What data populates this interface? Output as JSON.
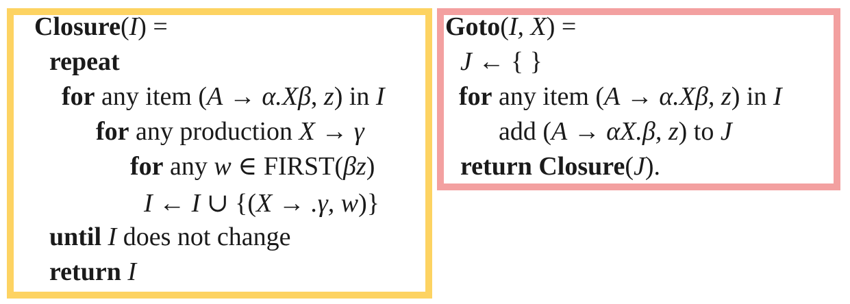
{
  "closure": {
    "heading": {
      "name": "Closure",
      "arg": "I",
      "suffix": ") ="
    },
    "repeat_kw": "repeat",
    "for_item": {
      "kw": "for",
      "pre": "any item (",
      "A": "A",
      "arrow": "→",
      "alpha": "α.",
      "X": "Xβ",
      "z": "z",
      "in": ") in",
      "I": "I"
    },
    "for_prod": {
      "kw": "for",
      "pre": "any production",
      "X": "X",
      "arrow": "→",
      "gamma": "γ"
    },
    "for_w": {
      "kw": "for",
      "pre": "any",
      "w": "w",
      "elem": "∈ FIRST(",
      "bz": "βz",
      "close": ")"
    },
    "assign": {
      "I1": "I",
      "larrow": "←",
      "I2": "I",
      "union": "∪ {(",
      "X": "X",
      "arrow": "→",
      "dg": ".γ,",
      "w": "w",
      "close": ")}"
    },
    "until": {
      "kw": "until",
      "I": "I",
      "rest": "does not change"
    },
    "ret": {
      "kw": "return",
      "I": "I"
    }
  },
  "goto": {
    "heading": {
      "name": "Goto",
      "args": "I, X",
      "suffix": ") ="
    },
    "init": {
      "J": "J",
      "larrow": "←",
      "set": "{ }"
    },
    "for_item": {
      "kw": "for",
      "pre": "any item (",
      "A": "A",
      "arrow": "→",
      "alpha": "α.",
      "X": "Xβ,",
      "z": "z",
      "in": ") in",
      "I": "I"
    },
    "add": {
      "pre": "add (",
      "A": "A",
      "arrow": "→",
      "alpha": "αX.β,",
      "z": "z",
      "mid": ") to",
      "J": "J"
    },
    "ret": {
      "kw": "return",
      "fn": "Closure",
      "J": "J",
      "close": ")."
    }
  }
}
